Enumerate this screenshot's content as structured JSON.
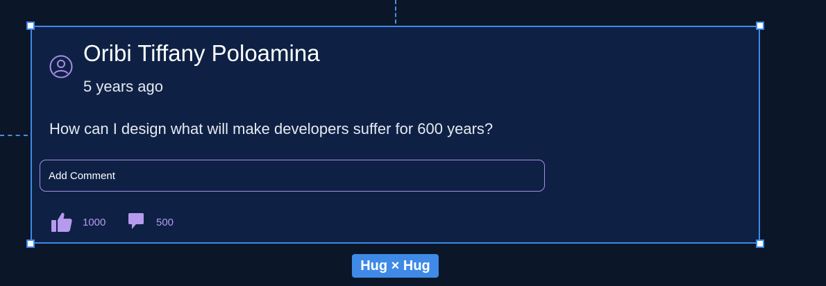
{
  "post": {
    "author": "Oribi Tiffany Poloamina",
    "timestamp": "5 years ago",
    "question": "How can I design what will make developers suffer for 600 years?",
    "comment_placeholder": "Add Comment",
    "likes": "1000",
    "comments": "500",
    "icons": {
      "avatar": "user-circle-icon",
      "like": "thumbs-up-icon",
      "comment": "speech-bubble-icon"
    }
  },
  "selection": {
    "size_label": "Hug × Hug"
  },
  "colors": {
    "background": "#0b1629",
    "card": "#0e2145",
    "selection_accent": "#3f8ae6",
    "icon_accent": "#b59aee"
  }
}
